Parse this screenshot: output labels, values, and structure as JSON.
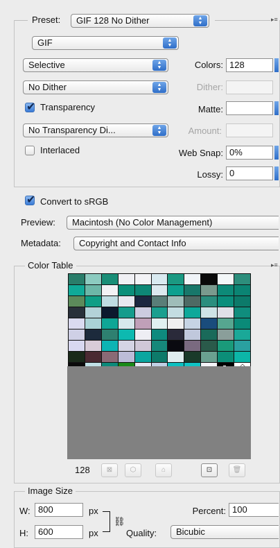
{
  "preset": {
    "label": "Preset:",
    "value": "GIF 128 No Dither"
  },
  "format": {
    "value": "GIF"
  },
  "reduction": {
    "value": "Selective"
  },
  "dither_algorithm": {
    "value": "No Dither"
  },
  "transparency": {
    "label": "Transparency",
    "checked": true
  },
  "transparency_dither": {
    "value": "No Transparency Di..."
  },
  "interlaced": {
    "label": "Interlaced",
    "checked": false
  },
  "colors": {
    "label": "Colors:",
    "value": "128"
  },
  "dither": {
    "label": "Dither:",
    "value": ""
  },
  "matte": {
    "label": "Matte:",
    "value": ""
  },
  "amount": {
    "label": "Amount:",
    "value": ""
  },
  "web_snap": {
    "label": "Web Snap:",
    "value": "0%"
  },
  "lossy": {
    "label": "Lossy:",
    "value": "0"
  },
  "convert_srgb": {
    "label": "Convert to sRGB",
    "checked": true
  },
  "preview": {
    "label": "Preview:",
    "value": "Macintosh (No Color Management)"
  },
  "metadata": {
    "label": "Metadata:",
    "value": "Copyright and Contact Info"
  },
  "color_table": {
    "title": "Color Table",
    "count": "128",
    "swatches": [
      "#2a7d6a",
      "#8ccbc0",
      "#1a8e77",
      "#f0f0f4",
      "#f3f3f6",
      "#d9eaf0",
      "#1b9982",
      "#f0f4f8",
      "#0a0a0a",
      "#f3f7f8",
      "#2d8e7c",
      "#10aa98",
      "#6cb7a8",
      "#f2f2f5",
      "#0b8f7a",
      "#0e8776",
      "#dce9ee",
      "#0da08f",
      "#18776a",
      "#7a9a8e",
      "#0d8a78",
      "#0b8473",
      "#5c8a5b",
      "#0f9e86",
      "#c0dde3",
      "#e8e8f0",
      "#1b2740",
      "#5a7e78",
      "#9fbdb9",
      "#4e6a64",
      "#2b8e7e",
      "#0a8e7c",
      "#0c7a6a",
      "#28303a",
      "#b3d2d8",
      "#0c1a2e",
      "#159c8c",
      "#cccce0",
      "#1a9f8f",
      "#c3dde2",
      "#0da89a",
      "#cfe3e6",
      "#e0e0e8",
      "#0f8d7d",
      "#dadaf0",
      "#aad2d6",
      "#0fa696",
      "#d6e8ec",
      "#c0a0b8",
      "#e0f0f0",
      "#f0f0f0",
      "#c6d4e4",
      "#1a4c7c",
      "#56a690",
      "#0a8a78",
      "#cfd0e6",
      "#1c2a3c",
      "#2e8070",
      "#0db9b0",
      "#eeeef4",
      "#0e8a7e",
      "#2a2a3a",
      "#c0c8dc",
      "#1a6a5a",
      "#8a9e9a",
      "#1aa898",
      "#d8d8f0",
      "#d8ccd8",
      "#0cb4b4",
      "#d4d4e4",
      "#d0c8d8",
      "#16887a",
      "#0a0a10",
      "#7a6a80",
      "#2a5a4a",
      "#1a9a7a",
      "#2aa0a0",
      "#1a2a1a",
      "#4a2a32",
      "#8a6a76",
      "#bcbcd8",
      "#0aa6a0",
      "#0d7a6a",
      "#e0eef0",
      "#1a3a2a",
      "#6aa090",
      "#0b8e78",
      "#0cb6a8",
      "#0a0a0a",
      "#c0e0e6",
      "#0c8a7a",
      "#1a8a18",
      "#e8e8f4",
      "#c0d0e4",
      "#0cc0c0",
      "#10c4c4",
      "#f4f4f8",
      "#000000",
      "#ffffff"
    ],
    "toolbar_icons": [
      "map-selected-to-transparent-icon",
      "lock-web-safe-icon",
      "lock-color-icon",
      "new-color-icon",
      "delete-color-icon"
    ]
  },
  "image_size": {
    "title": "Image Size",
    "w_label": "W:",
    "w_value": "800",
    "w_unit": "px",
    "h_label": "H:",
    "h_value": "600",
    "h_unit": "px",
    "percent_label": "Percent:",
    "percent_value": "100",
    "quality_label": "Quality:",
    "quality_value": "Bicubic"
  }
}
